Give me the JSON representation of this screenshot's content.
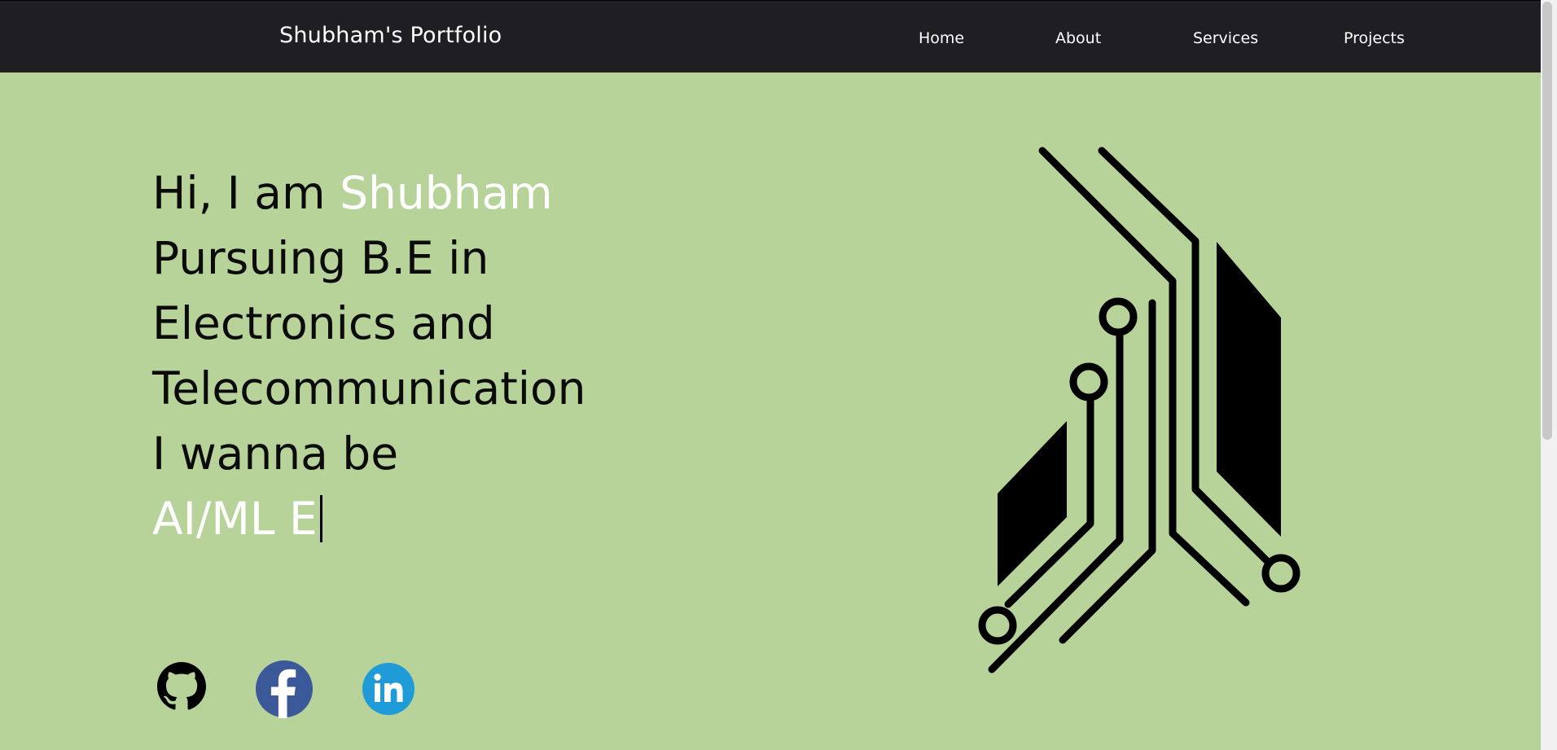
{
  "header": {
    "brand": "Shubham's Portfolio",
    "nav": [
      {
        "label": "Home"
      },
      {
        "label": "About"
      },
      {
        "label": "Services"
      },
      {
        "label": "Projects"
      }
    ]
  },
  "hero": {
    "greeting": "Hi, I am ",
    "name": "Shubham",
    "line2": "Pursuing B.E in",
    "line3": "Electronics and",
    "line4": "Telecommunication",
    "line5": "I wanna be",
    "typed": "AI/ML E"
  },
  "social": {
    "icons": [
      "github-icon",
      "facebook-icon",
      "linkedin-icon"
    ],
    "colors": {
      "facebook": "#3b5998",
      "linkedin": "#1f9bd7",
      "github": "#000000"
    }
  },
  "theme": {
    "header_bg": "#1f1f23",
    "hero_bg": "#b8d399",
    "highlight": "#ffffff"
  }
}
